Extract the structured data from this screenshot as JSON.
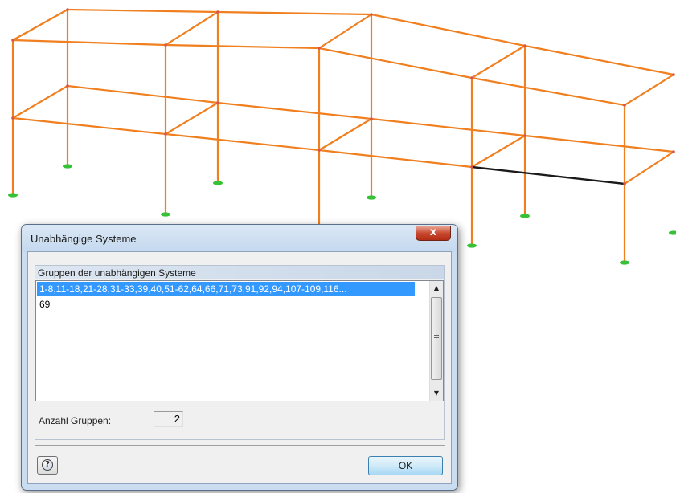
{
  "dialog": {
    "title": "Unabhängige Systeme",
    "close_label": "x",
    "group_label": "Gruppen der unabhängigen Systeme",
    "groups": [
      "1-8,11-18,21-28,31-33,39,40,51-62,64,66,71,73,91,92,94,107-109,116...",
      "69"
    ],
    "count_label": "Anzahl Gruppen:",
    "count_value": "2",
    "ok_label": "OK",
    "help_glyph": "?"
  },
  "colors": {
    "member": "#f07f1f",
    "selected_member": "#1a1a1a",
    "support": "#36c136",
    "selection": "#3399ff"
  },
  "icons": {
    "help": "help-icon",
    "close": "close-icon"
  }
}
